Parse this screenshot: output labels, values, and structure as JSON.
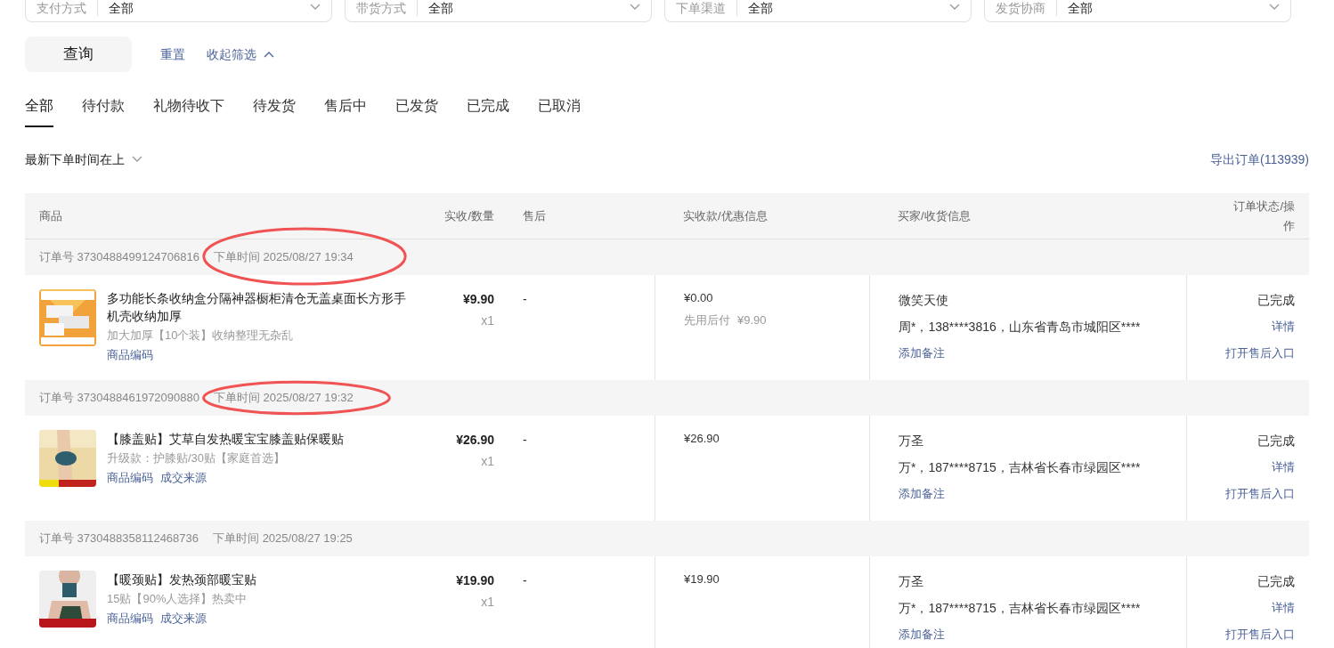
{
  "filters": [
    {
      "label": "支付方式",
      "value": "全部"
    },
    {
      "label": "带货方式",
      "value": "全部"
    },
    {
      "label": "下单渠道",
      "value": "全部"
    },
    {
      "label": "发货协商",
      "value": "全部"
    }
  ],
  "actions": {
    "query": "查询",
    "reset": "重置",
    "collapse": "收起筛选"
  },
  "tabs": [
    {
      "label": "全部",
      "selected": true
    },
    {
      "label": "待付款",
      "selected": false
    },
    {
      "label": "礼物待收下",
      "selected": false
    },
    {
      "label": "待发货",
      "selected": false
    },
    {
      "label": "售后中",
      "selected": false
    },
    {
      "label": "已发货",
      "selected": false
    },
    {
      "label": "已完成",
      "selected": false
    },
    {
      "label": "已取消",
      "selected": false
    }
  ],
  "sort": {
    "label": "最新下单时间在上"
  },
  "export_link": "导出订单(113939)",
  "table": {
    "columns": [
      "商品",
      "实收/数量",
      "售后",
      "实收款/优惠信息",
      "买家/收货信息",
      "订单状态/操作"
    ],
    "orders": [
      {
        "order_no": "订单号 3730488499124706816",
        "time": "下单时间 2025/08/27 19:34",
        "circled": true,
        "title": "多功能长条收纳盒分隔神器橱柜清仓无盖桌面长方形手机壳收纳加厚",
        "spec": "加大加厚【10个装】收纳整理无杂乱",
        "links": [
          "商品编码"
        ],
        "price": "¥9.90",
        "qty": "x1",
        "after_sale": "-",
        "paid": "¥0.00",
        "discount_label": "先用后付",
        "discount": "¥9.90",
        "buyer": "微笑天使",
        "address": "周*，138****3816，山东省青岛市城阳区****",
        "note_link": "添加备注",
        "status": "已完成",
        "ops": [
          "详情",
          "打开售后入口"
        ]
      },
      {
        "order_no": "订单号 3730488461972090880",
        "time": "下单时间 2025/08/27 19:32",
        "circled": true,
        "title": "【膝盖贴】艾草自发热暖宝宝膝盖贴保暖贴",
        "spec": "升级款：护膝贴/30贴【家庭首选】",
        "links": [
          "商品编码",
          "成交来源"
        ],
        "price": "¥26.90",
        "qty": "x1",
        "after_sale": "-",
        "paid": "¥26.90",
        "buyer": "万圣",
        "address": "万*，187****8715，吉林省长春市绿园区****",
        "note_link": "添加备注",
        "status": "已完成",
        "ops": [
          "详情",
          "打开售后入口"
        ]
      },
      {
        "order_no": "订单号 3730488358112468736",
        "time": "下单时间 2025/08/27 19:25",
        "circled": false,
        "title": "【暖颈贴】发热颈部暖宝贴",
        "spec": "15贴【90%人选择】热卖中",
        "links": [
          "商品编码",
          "成交来源"
        ],
        "price": "¥19.90",
        "qty": "x1",
        "after_sale": "-",
        "paid": "¥19.90",
        "buyer": "万圣",
        "address": "万*，187****8715，吉林省长春市绿园区****",
        "note_link": "添加备注",
        "status": "已完成",
        "ops": [
          "详情",
          "打开售后入口"
        ]
      }
    ]
  }
}
